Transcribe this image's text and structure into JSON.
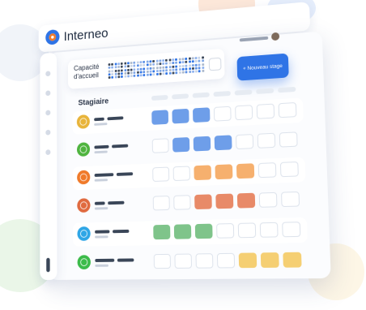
{
  "header": {
    "brand": "Interneo",
    "logo_icon": "interneo-logo-icon"
  },
  "capacity": {
    "label": "Capacité d'accueil",
    "action_icon": "list-icon"
  },
  "new_stage_button": {
    "label": "+ Nouveau stage"
  },
  "planning": {
    "title": "Stagiaire",
    "rows": [
      {
        "avatar_color": "#e8b43a",
        "cells": [
          "blue",
          "blue",
          "blue",
          "empty",
          "empty",
          "empty",
          "empty"
        ]
      },
      {
        "avatar_color": "#4fb43f",
        "cells": [
          "empty",
          "blue",
          "blue",
          "blue",
          "empty",
          "empty",
          "empty"
        ]
      },
      {
        "avatar_color": "#f07a2a",
        "cells": [
          "empty",
          "empty",
          "orange",
          "orange",
          "orange",
          "empty",
          "empty"
        ]
      },
      {
        "avatar_color": "#e06a3f",
        "cells": [
          "empty",
          "empty",
          "red",
          "red",
          "red",
          "empty",
          "empty"
        ]
      },
      {
        "avatar_color": "#2fa6e6",
        "cells": [
          "green",
          "green",
          "green",
          "empty",
          "empty",
          "empty",
          "empty"
        ]
      },
      {
        "avatar_color": "#3cbb4a",
        "cells": [
          "empty",
          "empty",
          "empty",
          "empty",
          "yellow",
          "yellow",
          "yellow"
        ]
      }
    ]
  },
  "colors": {
    "accent": "#2f74e6",
    "blue": "#6e9ee9",
    "orange": "#f6b06e",
    "red": "#e88a68",
    "green": "#7fc48a",
    "yellow": "#f5cf73",
    "text": "#1d2a3f"
  }
}
